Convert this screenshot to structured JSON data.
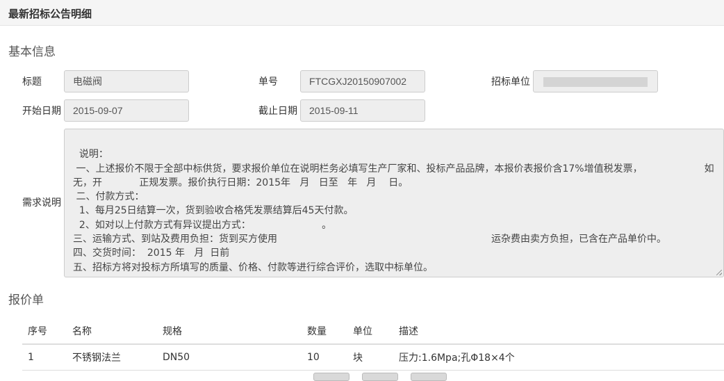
{
  "header": {
    "title": "最新招标公告明细"
  },
  "basic": {
    "section_title": "基本信息",
    "title_label": "标题",
    "title_value": "电磁阀",
    "number_label": "单号",
    "number_value": "FTCGXJ20150907002",
    "unit_label": "招标单位",
    "unit_value": "",
    "start_label": "开始日期",
    "start_value": "2015-09-07",
    "end_label": "截止日期",
    "end_value": "2015-09-11",
    "req_label": "需求说明",
    "req_text": "说明：\n 一、上述报价不限于全部中标供货，要求报价单位在说明栏务必填写生产厂家和、投标产品品牌，本报价表报价含17%增值税发票，                    如无，开            正规发票。报价执行日期：2015年   月   日至   年   月    日。\n 二、付款方式：\n  1、每月25日结算一次，货到验收合格凭发票结算后45天付款。\n  2、如对以上付款方式有异议提出方式：                       。\n三、运输方式、到站及费用负担：货到买方使用                      运杂费由卖方负担，已含在产品单价中。\n四、交货时间：  2015 年   月  日前\n五、招标方将对投标方所填写的质量、价格、付款等进行综合评价，选取中标单位。"
  },
  "quote": {
    "section_title": "报价单",
    "columns": [
      "序号",
      "名称",
      "规格",
      "数量",
      "单位",
      "描述"
    ],
    "rows": [
      [
        "1",
        "不锈钢法兰",
        "DN50",
        "10",
        "块",
        "压力:1.6Mpa;孔Φ18×4个"
      ]
    ]
  }
}
